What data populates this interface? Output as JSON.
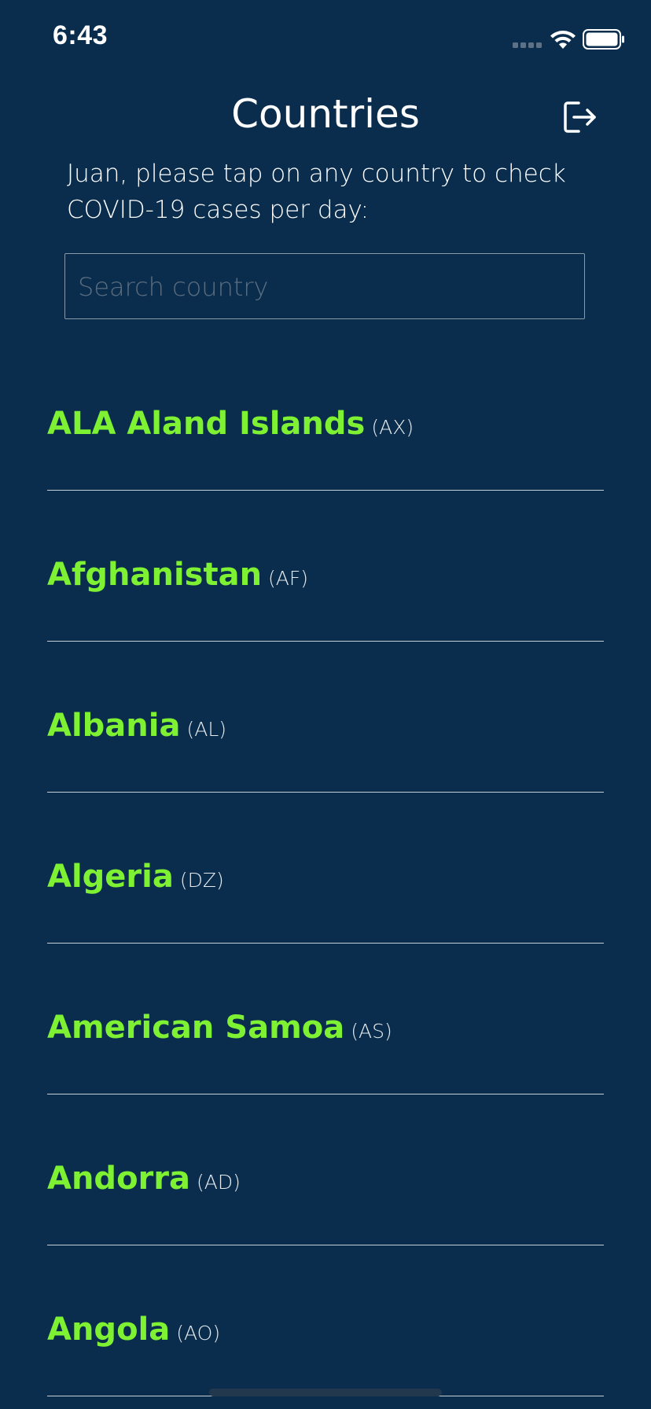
{
  "status_bar": {
    "time": "6:43",
    "icons": [
      "signal-icon",
      "wifi-icon",
      "battery-icon"
    ]
  },
  "header": {
    "title": "Countries",
    "logout_icon": "logout-icon"
  },
  "instructions": "Juan, please tap on any country to check COVID-19 cases per day:",
  "search": {
    "placeholder": "Search country",
    "value": ""
  },
  "countries": [
    {
      "name": "ALA Aland Islands",
      "code": "(AX)"
    },
    {
      "name": "Afghanistan",
      "code": "(AF)"
    },
    {
      "name": "Albania",
      "code": "(AL)"
    },
    {
      "name": "Algeria",
      "code": "(DZ)"
    },
    {
      "name": "American Samoa",
      "code": "(AS)"
    },
    {
      "name": "Andorra",
      "code": "(AD)"
    },
    {
      "name": "Angola",
      "code": "(AO)"
    }
  ],
  "colors": {
    "background": "#0a2d4d",
    "country_name": "#7ff133",
    "text": "#ffffff"
  }
}
